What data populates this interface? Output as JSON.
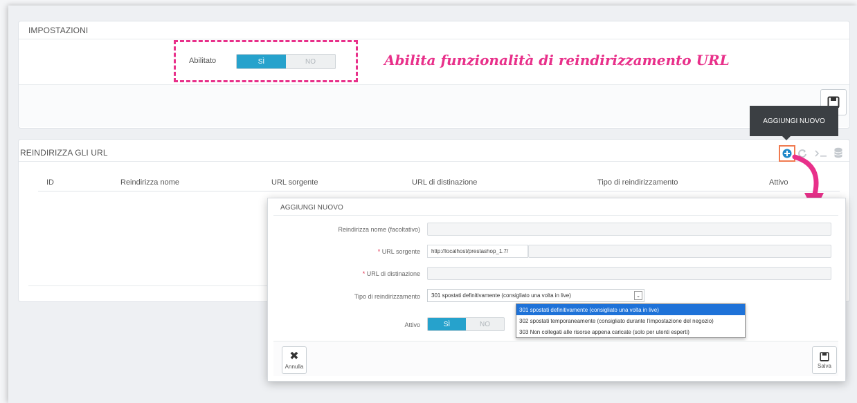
{
  "settings": {
    "title": "IMPOSTAZIONI",
    "enabled_label": "Abilitato",
    "on": "SÌ",
    "off": "NO",
    "annotation": "Abilita funzionalità di reindirizzamento URL"
  },
  "redirects": {
    "title": "REINDIRIZZA GLI URL",
    "tooltip": "AGGIUNGI NUOVO",
    "columns": [
      "ID",
      "Reindirizza nome",
      "URL sorgente",
      "URL di distinazione",
      "Tipo di reindirizzamento",
      "Attivo"
    ]
  },
  "modal": {
    "title": "AGGIUNGI NUOVO",
    "name_label": "Reindirizza nome (facoltativo)",
    "source_label": "URL sorgente",
    "source_prefix": "http://localhost/prestashop_1.7/",
    "dest_label": "URL di distinazione",
    "type_label": "Tipo di reindirizzamento",
    "type_selected": "301 spostati definitivamente (consigliato una volta in live)",
    "type_options": [
      "301 spostati definitivamente (consigliato una volta in live)",
      "302 spostati temporaneamente (consigliato durante l'impostazione del negozio)",
      "303 Non collegati alle risorse appena caricate (solo per utenti esperti)"
    ],
    "active_label": "Attivo",
    "on": "SÌ",
    "off": "NO",
    "cancel_label": "Annulla",
    "save_label": "Salva"
  },
  "colors": {
    "accent": "#26a2cc",
    "annotation": "#e8308a",
    "highlight_box": "#f07a50",
    "selected_option": "#1e72d8"
  }
}
